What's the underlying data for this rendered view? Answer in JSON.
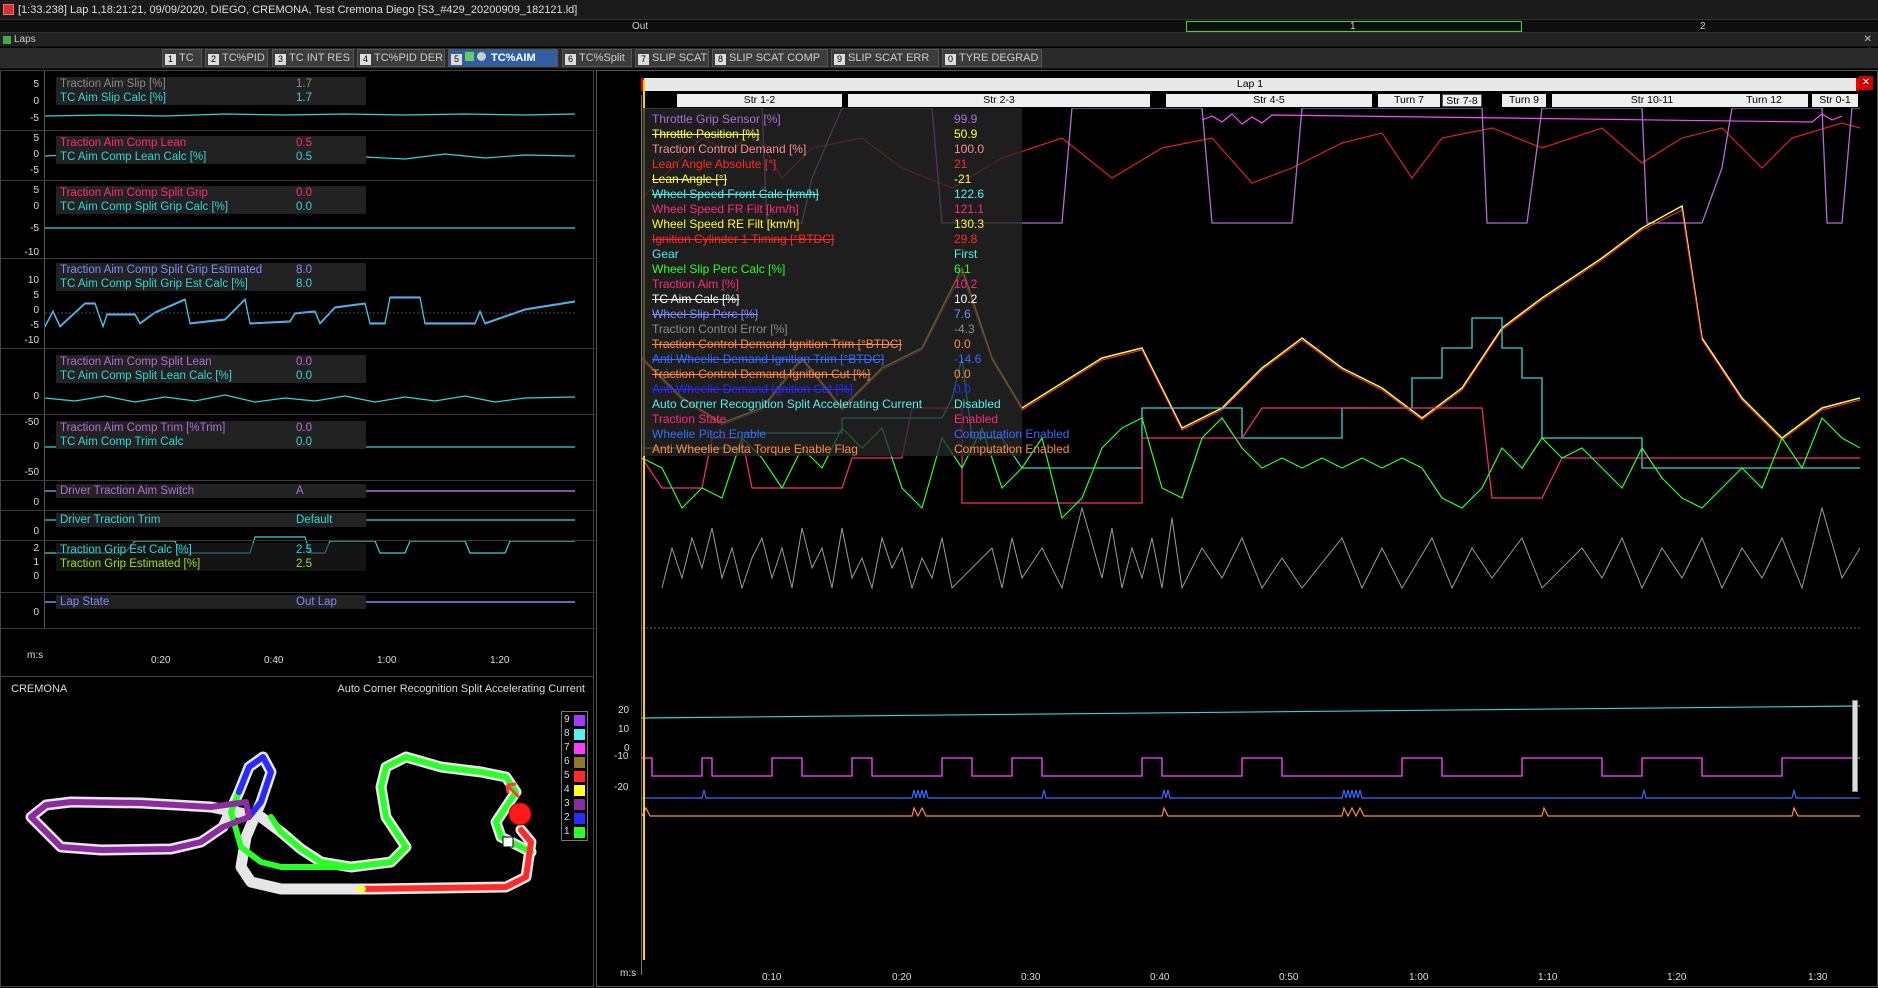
{
  "window": {
    "title": "[1:33.238] Lap 1,18:21:21, 09/09/2020,  DIEGO, CREMONA, Test Cremona Diego [S3_#429_20200909_182121.ld]"
  },
  "lap_strip": {
    "out_label": "Out",
    "lap1": "1",
    "lap2": "2"
  },
  "laps_bar": {
    "label": "Laps"
  },
  "toolbar": {
    "selector_value": "TC",
    "tabs": [
      {
        "num": "1",
        "label": "TC"
      },
      {
        "num": "2",
        "label": "TC%PID"
      },
      {
        "num": "3",
        "label": "TC INT RES"
      },
      {
        "num": "4",
        "label": "TC%PID DER"
      },
      {
        "num": "5",
        "label": "TC%AIM"
      },
      {
        "num": "6",
        "label": "TC%Split"
      },
      {
        "num": "7",
        "label": "SLIP SCAT"
      },
      {
        "num": "8",
        "label": "SLIP SCAT COMP"
      },
      {
        "num": "9",
        "label": "SLIP SCAT ERR"
      },
      {
        "num": "0",
        "label": "TYRE DEGRAD"
      }
    ]
  },
  "left_rows": [
    {
      "channels": [
        {
          "name": "Traction Aim Slip [%]",
          "value": "1.7",
          "color": "#8a8a8a"
        },
        {
          "name": "TC Aim Slip Calc [%]",
          "value": "1.7",
          "color": "#33d6d6"
        }
      ],
      "ticks": [
        "5",
        "0",
        "-5"
      ]
    },
    {
      "channels": [
        {
          "name": "Traction Aim Comp Lean",
          "value": "0.5",
          "color": "#ff2a7a"
        },
        {
          "name": "TC Aim Comp Lean Calc [%]",
          "value": "0.5",
          "color": "#33d6d6"
        }
      ],
      "ticks": [
        "5",
        "0",
        "-5"
      ]
    },
    {
      "channels": [
        {
          "name": "Traction Aim Comp Split Grip",
          "value": "0.0",
          "color": "#ff2a7a"
        },
        {
          "name": "TC Aim Comp Split Grip Calc [%]",
          "value": "0.0",
          "color": "#33d6d6"
        }
      ],
      "ticks": [
        "5",
        "0",
        "-5",
        "-10"
      ]
    },
    {
      "channels": [
        {
          "name": "Traction Aim Comp Split Grip Estimated",
          "value": "8.0",
          "color": "#7a8cff"
        },
        {
          "name": "TC Aim Comp Split Grip Est Calc [%]",
          "value": "8.0",
          "color": "#33d6d6"
        }
      ],
      "ticks": [
        "10",
        "5",
        "0",
        "-5",
        "-10"
      ]
    },
    {
      "channels": [
        {
          "name": "Traction Aim Comp Split Lean",
          "value": "0.0",
          "color": "#b36bd6"
        },
        {
          "name": "TC Aim Comp Split Lean Calc [%]",
          "value": "0.0",
          "color": "#33d6d6"
        }
      ],
      "ticks": [
        "0",
        "-50"
      ]
    },
    {
      "channels": [
        {
          "name": "Traction Aim Comp Trim [%Trim]",
          "value": "0.0",
          "color": "#b36bd6"
        },
        {
          "name": "TC Aim Comp Trim Calc",
          "value": "0.0",
          "color": "#33d6d6"
        }
      ],
      "ticks": [
        "0",
        "-50"
      ]
    },
    {
      "channels": [
        {
          "name": "Driver Traction Aim Switch",
          "value": "A",
          "color": "#b36bd6"
        }
      ],
      "ticks": [
        "0"
      ]
    },
    {
      "channels": [
        {
          "name": "Driver Traction Trim",
          "value": "Default",
          "color": "#33d6d6"
        }
      ],
      "ticks": [
        "0"
      ]
    },
    {
      "channels": [
        {
          "name": "Traction Grip Est Calc [%]",
          "value": "2.5",
          "color": "#33d6d6"
        },
        {
          "name": "Traction Grip Estimated [%]",
          "value": "2.5",
          "color": "#9adf2a"
        }
      ],
      "ticks": [
        "2",
        "1",
        "0"
      ]
    },
    {
      "channels": [
        {
          "name": "Lap State",
          "value": "Out Lap",
          "color": "#7a8cff"
        }
      ],
      "ticks": [
        "0"
      ]
    }
  ],
  "left_xaxis": {
    "unit": "m:s",
    "ticks": [
      "0:20",
      "0:40",
      "1:00",
      "1:20"
    ]
  },
  "track": {
    "name": "CREMONA",
    "channel": "Auto Corner Recognition Split Accelerating Current",
    "legend": [
      {
        "n": "9",
        "color": "#9b3cff"
      },
      {
        "n": "8",
        "color": "#55f0f0"
      },
      {
        "n": "7",
        "color": "#ff3cff"
      },
      {
        "n": "6",
        "color": "#8c7a2a"
      },
      {
        "n": "5",
        "color": "#ff2a2a"
      },
      {
        "n": "4",
        "color": "#ffff2a"
      },
      {
        "n": "3",
        "color": "#8c2aa0"
      },
      {
        "n": "2",
        "color": "#2a2aff"
      },
      {
        "n": "1",
        "color": "#2aff2a"
      }
    ]
  },
  "right": {
    "lap_label": "Lap 1",
    "segments": [
      "Str 1-2",
      "Str 2-3",
      "Str 4-5",
      "Turn 7",
      "Str 7-8",
      "Turn 9",
      "Str 10-11",
      "Turn 12",
      "Str 0-1"
    ],
    "overlay": [
      {
        "name": "Throttle Grip Sensor [%]",
        "value": "99.9",
        "color": "#b36bd6",
        "strike": false
      },
      {
        "name": "Throttle Position [%]",
        "value": "50.9",
        "color": "#ffff55",
        "strike": true
      },
      {
        "name": "Traction Control Demand [%]",
        "value": "100.0",
        "color": "#ff8c8c",
        "strike": false
      },
      {
        "name": "Lean Angle Absolute [°]",
        "value": "21",
        "color": "#ff2a2a",
        "strike": false
      },
      {
        "name": "Lean Angle [°]",
        "value": "-21",
        "color": "#ffff55",
        "strike": true
      },
      {
        "name": "Wheel Speed Front Calc [km/h]",
        "value": "122.6",
        "color": "#55f0f0",
        "strike": true
      },
      {
        "name": "Wheel Speed FR Filt [km/h]",
        "value": "121.1",
        "color": "#ff2a7a",
        "strike": false
      },
      {
        "name": "Wheel Speed RE Filt [km/h]",
        "value": "130.3",
        "color": "#ffff2a",
        "strike": false
      },
      {
        "name": "Ignition Cylinder 1 Timing [°BTDC]",
        "value": "29.8",
        "color": "#ff2a2a",
        "strike": true
      },
      {
        "name": "Gear",
        "value": "First",
        "color": "#55f0f0",
        "strike": false
      },
      {
        "name": "Wheel Slip Perc Calc [%]",
        "value": "6.1",
        "color": "#2aff2a",
        "strike": false
      },
      {
        "name": "Traction Aim [%]",
        "value": "10.2",
        "color": "#ff2a7a",
        "strike": false
      },
      {
        "name": "TC Aim Calc [%]",
        "value": "10.2",
        "color": "#ffffff",
        "strike": true
      },
      {
        "name": "Wheel Slip Perc [%]",
        "value": "7.6",
        "color": "#7a8cff",
        "strike": true
      },
      {
        "name": "Traction Control Error [%]",
        "value": "-4.3",
        "color": "#8a8a8a",
        "strike": false
      },
      {
        "name": "Traction Control Demand Ignition Trim [°BTDC]",
        "value": "0.0",
        "color": "#ff8a4a",
        "strike": true
      },
      {
        "name": "Anti Wheelie Demand Ignition Trim [°BTDC]",
        "value": "-14.6",
        "color": "#3a6aff",
        "strike": true
      },
      {
        "name": "Traction Control Demand Ignition Cut [%]",
        "value": "0.0",
        "color": "#ff8a4a",
        "strike": true
      },
      {
        "name": "Anti Wheelie Demand Ignition Cut [%]",
        "value": "0.0",
        "color": "#2a2aff",
        "strike": true
      },
      {
        "name": "Auto Corner Recognition Split Accelerating Current",
        "value": "Disabled",
        "color": "#55f0f0",
        "strike": false
      },
      {
        "name": "Traction State",
        "value": "Enabled",
        "color": "#ff2a7a",
        "strike": false
      },
      {
        "name": "Wheelie Pitch Enable",
        "value": "Computation Enabled",
        "color": "#3a6aff",
        "strike": false
      },
      {
        "name": "Anti Wheelie Delta Torque Enable Flag",
        "value": "Computation Enabled",
        "color": "#ff8a4a",
        "strike": false
      }
    ],
    "yticks": [
      "20",
      "10",
      "0",
      "-10",
      "-20"
    ],
    "xaxis": {
      "unit": "m:s",
      "ticks": [
        "0:10",
        "0:20",
        "0:30",
        "0:40",
        "0:50",
        "1:00",
        "1:10",
        "1:20",
        "1:30"
      ]
    }
  }
}
